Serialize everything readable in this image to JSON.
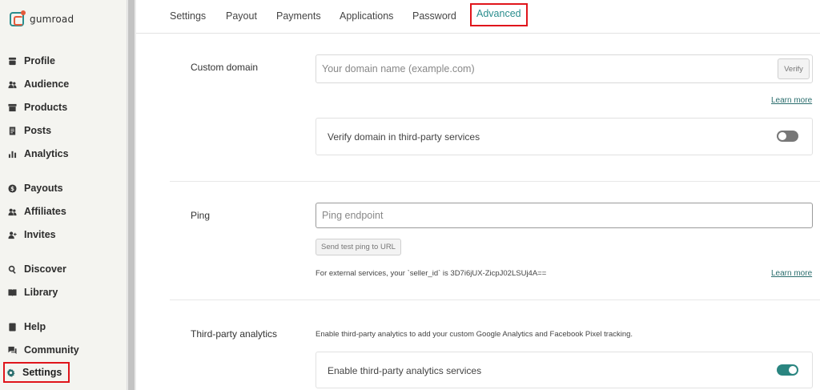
{
  "logo": {
    "text": "gumroad"
  },
  "sidebar": {
    "items": [
      {
        "label": "Profile",
        "icon": "store-icon"
      },
      {
        "label": "Audience",
        "icon": "people-icon"
      },
      {
        "label": "Products",
        "icon": "archive-icon"
      },
      {
        "label": "Posts",
        "icon": "document-icon"
      },
      {
        "label": "Analytics",
        "icon": "bar-chart-icon"
      },
      {
        "label": "Payouts",
        "icon": "dollar-circle-icon"
      },
      {
        "label": "Affiliates",
        "icon": "people-icon"
      },
      {
        "label": "Invites",
        "icon": "person-plus-icon"
      },
      {
        "label": "Discover",
        "icon": "search-icon"
      },
      {
        "label": "Library",
        "icon": "book-icon"
      },
      {
        "label": "Help",
        "icon": "book-icon"
      },
      {
        "label": "Community",
        "icon": "chat-icon"
      },
      {
        "label": "Settings",
        "icon": "gear-icon",
        "active": true
      }
    ]
  },
  "tabs": [
    {
      "label": "Settings"
    },
    {
      "label": "Payout"
    },
    {
      "label": "Payments"
    },
    {
      "label": "Applications"
    },
    {
      "label": "Password"
    },
    {
      "label": "Advanced",
      "active": true
    }
  ],
  "custom_domain": {
    "label": "Custom domain",
    "placeholder": "Your domain name (example.com)",
    "verify_button": "Verify",
    "learn_more": "Learn more",
    "third_party_label": "Verify domain in third-party services",
    "third_party_enabled": false
  },
  "ping": {
    "label": "Ping",
    "placeholder": "Ping endpoint",
    "test_button": "Send test ping to URL",
    "seller_id_text": "For external services, your `seller_id` is 3D7i6jUX-ZicpJ02LSUj4A==",
    "learn_more": "Learn more"
  },
  "analytics": {
    "label": "Third-party analytics",
    "description": "Enable third-party analytics to add your custom Google Analytics and Facebook Pixel tracking.",
    "toggle_label": "Enable third-party analytics services",
    "enabled": true
  },
  "colors": {
    "accent": "#2a8d8d",
    "highlight": "#e0151b"
  }
}
